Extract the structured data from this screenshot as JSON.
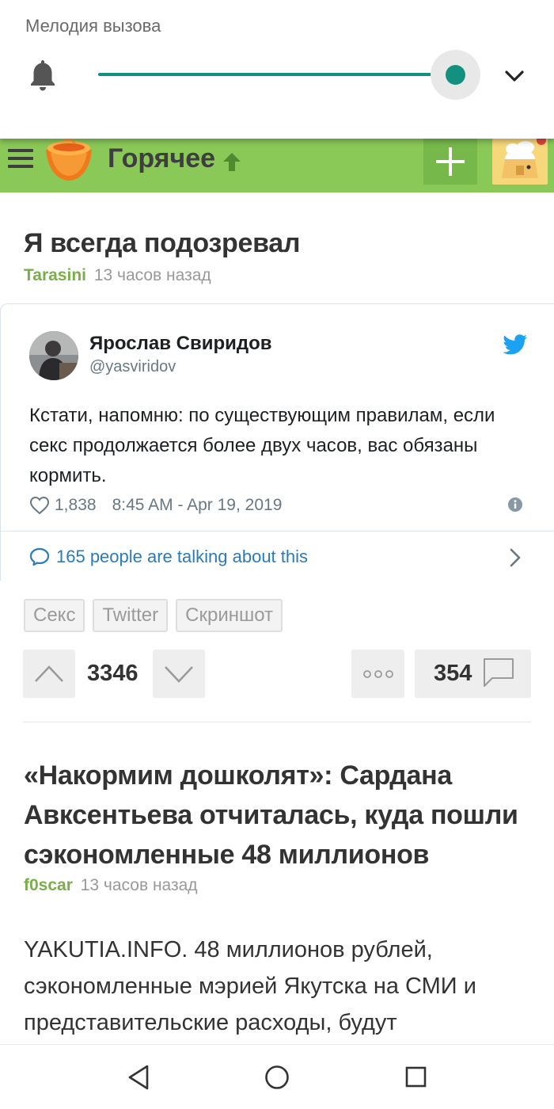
{
  "volume_panel": {
    "title": "Мелодия вызова",
    "level": 1.0,
    "accent_color": "#14907f",
    "icons": [
      "bell-icon",
      "chevron-down-icon"
    ]
  },
  "topbar": {
    "section_title": "Горячее",
    "bg_color": "#8ac858",
    "icons": [
      "menu-icon",
      "logo-icon",
      "up-arrow-icon",
      "plus-icon",
      "user-avatar"
    ]
  },
  "post1": {
    "title": "Я всегда подозревал",
    "author": "Tarasini",
    "time": "13 часов назад",
    "tweet": {
      "name": "Ярослав Свиридов",
      "handle": "@yasviridov",
      "text": "Кстати, напомню: по существующим правилам, если секс продолжается более двух часов, вас обязаны кормить.",
      "likes": "1,838",
      "timestamp": "8:45 AM - Apr 19, 2019",
      "discussion": "165 people are talking about this"
    },
    "tags": [
      "Секс",
      "Twitter",
      "Скриншот"
    ],
    "rating": "3346",
    "comments": "354"
  },
  "post2": {
    "title": "«Накормим дошколят»: Сардана Авксентьева отчиталась, куда пошли сэкономленные 48 миллионов",
    "author": "f0scar",
    "time": "13 часов назад",
    "body": "YAKUTIA.INFO. 48 миллионов рублей, сэкономленные мэрией Якутска на СМИ и представительские расходы, будут"
  },
  "navbar": {
    "icons": [
      "back-icon",
      "home-icon",
      "recents-icon"
    ]
  }
}
